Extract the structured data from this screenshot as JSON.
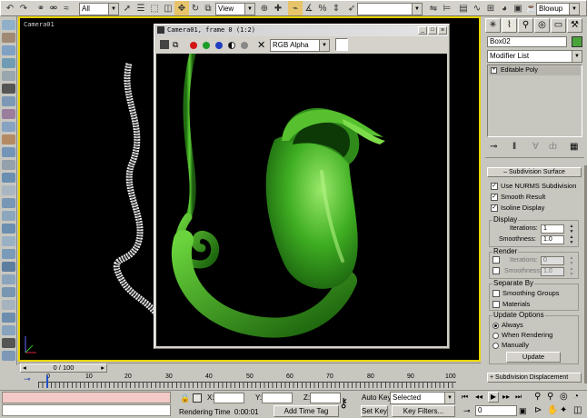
{
  "toolbar": {
    "selection_filter": "All",
    "ref_coord": "View",
    "named_selection": "",
    "render_type": "Blowup"
  },
  "viewport": {
    "label": "Camera01"
  },
  "frame_window": {
    "title": "Camera01, frame 0 (1:2)",
    "channel": "RGB Alpha"
  },
  "command_panel": {
    "object_name": "Box02",
    "object_color": "#4aa33a",
    "modifier_list": "Modifier List",
    "stack_item": "Editable Poly",
    "rollout_title": "Subdivision Surface",
    "use_nurms": "Use NURMS Subdivision",
    "smooth_result": "Smooth Result",
    "isoline_display": "Isoline Display",
    "display_group": "Display",
    "render_group": "Render",
    "iterations_label": "Iterations:",
    "smoothness_label": "Smoothness:",
    "display_iterations": "1",
    "display_smoothness": "1.0",
    "render_iterations": "0",
    "render_smoothness": "1.0",
    "separate_group": "Separate By",
    "smoothing_groups": "Smoothing Groups",
    "materials": "Materials",
    "update_group": "Update Options",
    "always": "Always",
    "when_rendering": "When Rendering",
    "manually": "Manually",
    "update_button": "Update",
    "next_rollout": "Subdivision Displacement"
  },
  "timeline": {
    "slider_label": "0 / 100",
    "ticks": [
      "0",
      "10",
      "20",
      "30",
      "40",
      "50",
      "60",
      "70",
      "80",
      "90",
      "100"
    ]
  },
  "status": {
    "x_label": "X:",
    "y_label": "Y:",
    "z_label": "Z:",
    "auto_key": "Auto Key",
    "selected": "Selected",
    "set_key": "Set Key",
    "key_filters": "Key Filters...",
    "rendering_time": "Rendering Time  0:00:01",
    "add_time_tag": "Add Time Tag",
    "frame_value": "0"
  }
}
